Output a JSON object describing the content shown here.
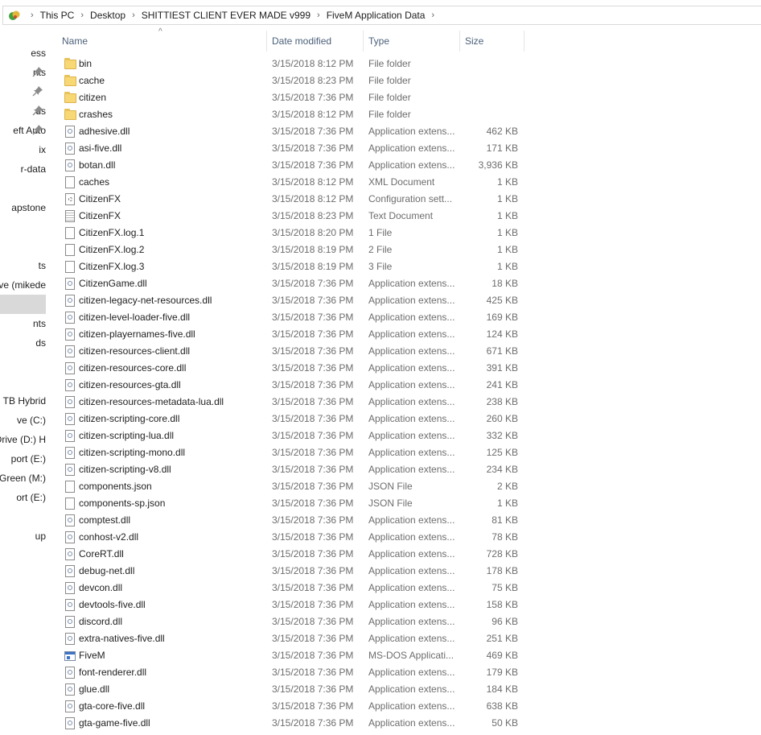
{
  "address": {
    "crumbs": [
      "This PC",
      "Desktop",
      "SHITTIEST CLIENT EVER MADE v999",
      "FiveM Application Data"
    ]
  },
  "nav": {
    "items": [
      {
        "label": "ess",
        "pinned": false,
        "selected": false
      },
      {
        "label": "nts",
        "pinned": true,
        "selected": false
      },
      {
        "label": "",
        "pinned": true,
        "selected": false
      },
      {
        "label": "ds",
        "pinned": true,
        "selected": false
      },
      {
        "label": "eft Auto",
        "pinned": true,
        "selected": false
      },
      {
        "label": "ix",
        "pinned": false,
        "selected": false
      },
      {
        "label": "r-data",
        "pinned": false,
        "selected": false
      },
      {
        "label": "",
        "pinned": false,
        "selected": false
      },
      {
        "label": "apstone",
        "pinned": false,
        "selected": false
      },
      {
        "label": "",
        "pinned": false,
        "selected": false
      },
      {
        "label": "",
        "pinned": false,
        "selected": false
      },
      {
        "label": "ts",
        "pinned": false,
        "selected": false
      },
      {
        "label": "ve (mikede",
        "pinned": false,
        "selected": false
      },
      {
        "label": "",
        "pinned": false,
        "selected": true
      },
      {
        "label": "nts",
        "pinned": false,
        "selected": false
      },
      {
        "label": "ds",
        "pinned": false,
        "selected": false
      },
      {
        "label": "",
        "pinned": false,
        "selected": false
      },
      {
        "label": "",
        "pinned": false,
        "selected": false
      },
      {
        "label": "TB Hybrid",
        "pinned": false,
        "selected": false
      },
      {
        "label": "ve (C:)",
        "pinned": false,
        "selected": false
      },
      {
        "label": "Drive (D:) H",
        "pinned": false,
        "selected": false
      },
      {
        "label": "port (E:)",
        "pinned": false,
        "selected": false
      },
      {
        "label": "Green (M:)",
        "pinned": false,
        "selected": false
      },
      {
        "label": "ort (E:)",
        "pinned": false,
        "selected": false
      },
      {
        "label": "",
        "pinned": false,
        "selected": false
      },
      {
        "label": "up",
        "pinned": false,
        "selected": false
      }
    ]
  },
  "columns": {
    "name": "Name",
    "date": "Date modified",
    "type": "Type",
    "size": "Size"
  },
  "files": [
    {
      "name": "bin",
      "date": "3/15/2018 8:12 PM",
      "type": "File folder",
      "size": "",
      "icon": "folder-icon"
    },
    {
      "name": "cache",
      "date": "3/15/2018 8:23 PM",
      "type": "File folder",
      "size": "",
      "icon": "folder-icon"
    },
    {
      "name": "citizen",
      "date": "3/15/2018 7:36 PM",
      "type": "File folder",
      "size": "",
      "icon": "folder-icon"
    },
    {
      "name": "crashes",
      "date": "3/15/2018 8:12 PM",
      "type": "File folder",
      "size": "",
      "icon": "folder-icon"
    },
    {
      "name": "adhesive.dll",
      "date": "3/15/2018 7:36 PM",
      "type": "Application extens...",
      "size": "462 KB",
      "icon": "dll-icon"
    },
    {
      "name": "asi-five.dll",
      "date": "3/15/2018 7:36 PM",
      "type": "Application extens...",
      "size": "171 KB",
      "icon": "dll-icon"
    },
    {
      "name": "botan.dll",
      "date": "3/15/2018 7:36 PM",
      "type": "Application extens...",
      "size": "3,936 KB",
      "icon": "dll-icon"
    },
    {
      "name": "caches",
      "date": "3/15/2018 8:12 PM",
      "type": "XML Document",
      "size": "1 KB",
      "icon": "file-icon"
    },
    {
      "name": "CitizenFX",
      "date": "3/15/2018 8:12 PM",
      "type": "Configuration sett...",
      "size": "1 KB",
      "icon": "config-file-icon"
    },
    {
      "name": "CitizenFX",
      "date": "3/15/2018 8:23 PM",
      "type": "Text Document",
      "size": "1 KB",
      "icon": "text-file-icon"
    },
    {
      "name": "CitizenFX.log.1",
      "date": "3/15/2018 8:20 PM",
      "type": "1 File",
      "size": "1 KB",
      "icon": "file-icon"
    },
    {
      "name": "CitizenFX.log.2",
      "date": "3/15/2018 8:19 PM",
      "type": "2 File",
      "size": "1 KB",
      "icon": "file-icon"
    },
    {
      "name": "CitizenFX.log.3",
      "date": "3/15/2018 8:19 PM",
      "type": "3 File",
      "size": "1 KB",
      "icon": "file-icon"
    },
    {
      "name": "CitizenGame.dll",
      "date": "3/15/2018 7:36 PM",
      "type": "Application extens...",
      "size": "18 KB",
      "icon": "dll-icon"
    },
    {
      "name": "citizen-legacy-net-resources.dll",
      "date": "3/15/2018 7:36 PM",
      "type": "Application extens...",
      "size": "425 KB",
      "icon": "dll-icon"
    },
    {
      "name": "citizen-level-loader-five.dll",
      "date": "3/15/2018 7:36 PM",
      "type": "Application extens...",
      "size": "169 KB",
      "icon": "dll-icon"
    },
    {
      "name": "citizen-playernames-five.dll",
      "date": "3/15/2018 7:36 PM",
      "type": "Application extens...",
      "size": "124 KB",
      "icon": "dll-icon"
    },
    {
      "name": "citizen-resources-client.dll",
      "date": "3/15/2018 7:36 PM",
      "type": "Application extens...",
      "size": "671 KB",
      "icon": "dll-icon"
    },
    {
      "name": "citizen-resources-core.dll",
      "date": "3/15/2018 7:36 PM",
      "type": "Application extens...",
      "size": "391 KB",
      "icon": "dll-icon"
    },
    {
      "name": "citizen-resources-gta.dll",
      "date": "3/15/2018 7:36 PM",
      "type": "Application extens...",
      "size": "241 KB",
      "icon": "dll-icon"
    },
    {
      "name": "citizen-resources-metadata-lua.dll",
      "date": "3/15/2018 7:36 PM",
      "type": "Application extens...",
      "size": "238 KB",
      "icon": "dll-icon"
    },
    {
      "name": "citizen-scripting-core.dll",
      "date": "3/15/2018 7:36 PM",
      "type": "Application extens...",
      "size": "260 KB",
      "icon": "dll-icon"
    },
    {
      "name": "citizen-scripting-lua.dll",
      "date": "3/15/2018 7:36 PM",
      "type": "Application extens...",
      "size": "332 KB",
      "icon": "dll-icon"
    },
    {
      "name": "citizen-scripting-mono.dll",
      "date": "3/15/2018 7:36 PM",
      "type": "Application extens...",
      "size": "125 KB",
      "icon": "dll-icon"
    },
    {
      "name": "citizen-scripting-v8.dll",
      "date": "3/15/2018 7:36 PM",
      "type": "Application extens...",
      "size": "234 KB",
      "icon": "dll-icon"
    },
    {
      "name": "components.json",
      "date": "3/15/2018 7:36 PM",
      "type": "JSON File",
      "size": "2 KB",
      "icon": "file-icon"
    },
    {
      "name": "components-sp.json",
      "date": "3/15/2018 7:36 PM",
      "type": "JSON File",
      "size": "1 KB",
      "icon": "file-icon"
    },
    {
      "name": "comptest.dll",
      "date": "3/15/2018 7:36 PM",
      "type": "Application extens...",
      "size": "81 KB",
      "icon": "dll-icon"
    },
    {
      "name": "conhost-v2.dll",
      "date": "3/15/2018 7:36 PM",
      "type": "Application extens...",
      "size": "78 KB",
      "icon": "dll-icon"
    },
    {
      "name": "CoreRT.dll",
      "date": "3/15/2018 7:36 PM",
      "type": "Application extens...",
      "size": "728 KB",
      "icon": "dll-icon"
    },
    {
      "name": "debug-net.dll",
      "date": "3/15/2018 7:36 PM",
      "type": "Application extens...",
      "size": "178 KB",
      "icon": "dll-icon"
    },
    {
      "name": "devcon.dll",
      "date": "3/15/2018 7:36 PM",
      "type": "Application extens...",
      "size": "75 KB",
      "icon": "dll-icon"
    },
    {
      "name": "devtools-five.dll",
      "date": "3/15/2018 7:36 PM",
      "type": "Application extens...",
      "size": "158 KB",
      "icon": "dll-icon"
    },
    {
      "name": "discord.dll",
      "date": "3/15/2018 7:36 PM",
      "type": "Application extens...",
      "size": "96 KB",
      "icon": "dll-icon"
    },
    {
      "name": "extra-natives-five.dll",
      "date": "3/15/2018 7:36 PM",
      "type": "Application extens...",
      "size": "251 KB",
      "icon": "dll-icon"
    },
    {
      "name": "FiveM",
      "date": "3/15/2018 7:36 PM",
      "type": "MS-DOS Applicati...",
      "size": "469 KB",
      "icon": "application-icon"
    },
    {
      "name": "font-renderer.dll",
      "date": "3/15/2018 7:36 PM",
      "type": "Application extens...",
      "size": "179 KB",
      "icon": "dll-icon"
    },
    {
      "name": "glue.dll",
      "date": "3/15/2018 7:36 PM",
      "type": "Application extens...",
      "size": "184 KB",
      "icon": "dll-icon"
    },
    {
      "name": "gta-core-five.dll",
      "date": "3/15/2018 7:36 PM",
      "type": "Application extens...",
      "size": "638 KB",
      "icon": "dll-icon"
    },
    {
      "name": "gta-game-five.dll",
      "date": "3/15/2018 7:36 PM",
      "type": "Application extens...",
      "size": "50 KB",
      "icon": "dll-icon"
    }
  ]
}
